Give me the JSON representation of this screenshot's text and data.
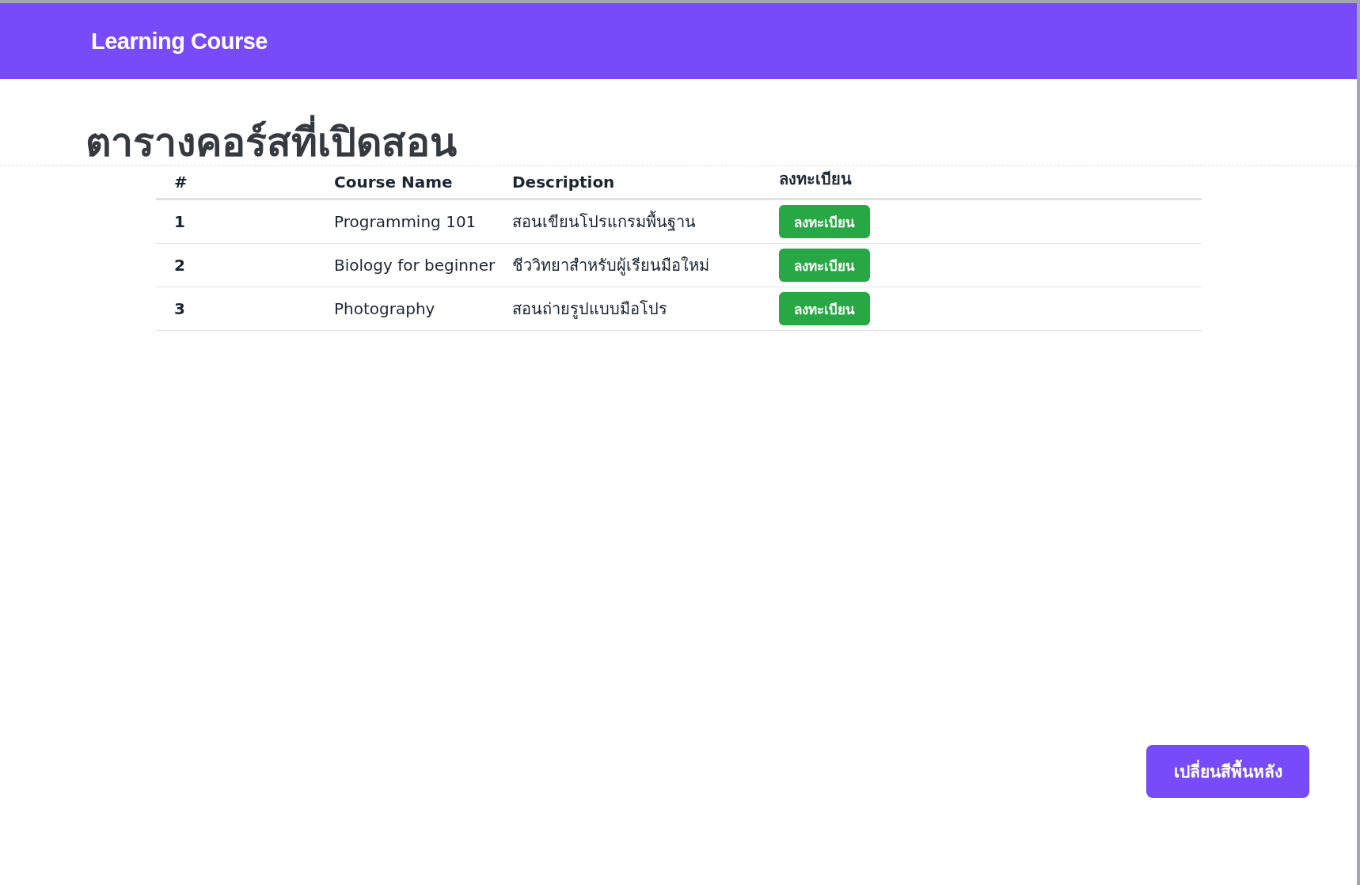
{
  "navbar": {
    "brand": "Learning Course"
  },
  "page_title": "ตารางคอร์สที่เปิดสอน",
  "table": {
    "columns": [
      "#",
      "Course Name",
      "Description",
      "ลงทะเบียน"
    ],
    "rows": [
      {
        "number": "1",
        "name": "Programming 101",
        "description": "สอนเขียนโปรแกรมพื้นฐาน",
        "action": "ลงทะเบียน"
      },
      {
        "number": "2",
        "name": "Biology for beginner",
        "description": "ชีววิทยาสำหรับผู้เรียนมือใหม่",
        "action": "ลงทะเบียน"
      },
      {
        "number": "3",
        "name": "Photography",
        "description": "สอนถ่ายรูปแบบมือโปร",
        "action": "ลงทะเบียน"
      }
    ]
  },
  "change_background_button": "เปลี่ยนสีพื้นหลัง"
}
